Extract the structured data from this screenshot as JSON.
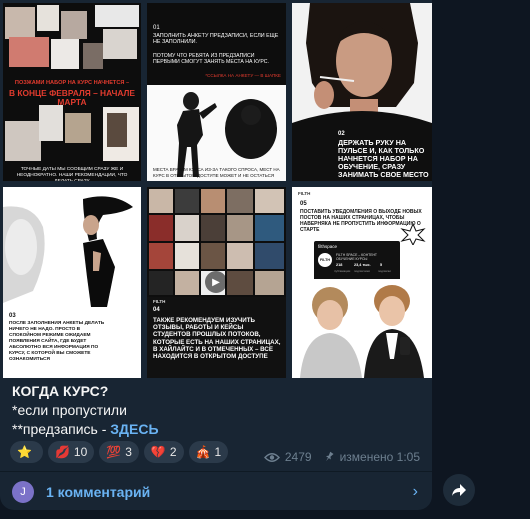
{
  "tiles": {
    "t1": {
      "headline_line1": "ПОЗЖАМИ НАБОР НА КУРС НАЧНЕТСЯ –",
      "headline_line2": "В КОНЦЕ ФЕВРАЛЯ – НАЧАЛЕ МАРТА",
      "footnote": "ТОЧНЫЕ ДАТЫ МЫ СООБЩИМ СРАЗУ ЖЕ И НЕОДНОКРАТНО. НАШИ РЕКОМЕНДАЦИИ, ЧТО ДЕЛАТЬ СРАЗУ"
    },
    "t2": {
      "number": "01",
      "text1": "ЗАПОЛНИТЬ АНКЕТУ ПРЕДЗАПИСИ, ЕСЛИ ЕЩЕ НЕ ЗАПОЛНИЛИ.",
      "text2": "ПОТОМУ ЧТО РЕБЯТА ИЗ ПРЕДЗАПИСИ ПЕРВЫМИ СМОГУТ ЗАНЯТЬ МЕСТА НА КУРС.",
      "text3": "*ССЫЛКА НА АНКЕТУ — В ШАПКЕ",
      "footnote": "МЕСТА ВРАЧАМ КУРСА ИЗ-ЗА ТАКОГО СПРОСА, МЕСТ НА КУРС В ОТКРЫТОМ ДОСТУПЕ МОЖЕТ И НЕ ОСТАТЬСЯ"
    },
    "t3": {
      "number": "02",
      "text": "ДЕРЖАТЬ РУКУ НА ПУЛЬСЕ И, КАК ТОЛЬКО НАЧНЕТСЯ НАБОР НА ОБУЧЕНИЕ, СРАЗУ ЗАНИМАТЬ СВОЕ МЕСТО"
    },
    "t4": {
      "brand": "FILTH",
      "number": "03",
      "text": "ПОСЛЕ ЗАПОЛНЕНИЯ АНКЕТЫ ДЕЛАТЬ НИЧЕГО НЕ НАДО. ПРОСТО В СПОКОЙНОМ РЕЖИМЕ ОЖИДАЕМ ПОЯВЛЕНИЯ САЙТА, ГДЕ БУДЕТ АБСОЛЮТНО ВСЯ ИНФОРМАЦИЯ ПО КУРСУ, С КОТОРОЙ ВЫ СМОЖЕТЕ ОЗНАКОМИТЬСЯ"
    },
    "t5": {
      "brand": "FILTH",
      "number": "04",
      "text": "ТАКЖЕ РЕКОМЕНДУЕМ ИЗУЧИТЬ ОТЗЫВЫ, РАБОТЫ И КЕЙСЫ СТУДЕНТОВ ПРОШЛЫХ ПОТОКОВ, КОТОРЫЕ ЕСТЬ НА НАШИХ СТРАНИЦАХ, В ХАЙЛАЙТС И В ОТМЕЧЕННЫХ – ВСЕ НАХОДИТСЯ В ОТКРЫТОМ ДОСТУПЕ"
    },
    "t6": {
      "brand": "FILTH",
      "number": "05",
      "text": "ПОСТАВИТЬ УВЕДОМЛЕНИЯ О ВЫХОДЕ НОВЫХ ПОСТОВ НА НАШИХ СТРАНИЦАХ, ЧТОБЫ НАВЕРНЯКА НЕ ПРОПУСТИТЬ ИНФОРМАЦИЮ О СТАРТЕ",
      "profile_handle": "filthspace",
      "profile_logo": "FILTH",
      "profile_bio": "FILTH SPACE – КОНТЕНТ ОБУЧЕНИЕ КУРСЫ",
      "stat1_value": "218",
      "stat1_label": "публикации",
      "stat2_value": "23,4 тыс.",
      "stat2_label": "подписчики",
      "stat3_value": "5",
      "stat3_label": "подписки"
    }
  },
  "caption": {
    "title": "КОГДА КУРС?",
    "line2": "*если пропустили",
    "line3_prefix": "**предзапись - ",
    "link": "ЗДЕСЬ"
  },
  "reactions": [
    {
      "emoji": "⭐",
      "count": ""
    },
    {
      "emoji": "💋",
      "count": "10"
    },
    {
      "emoji": "💯",
      "count": "3"
    },
    {
      "emoji": "💔",
      "count": "2"
    },
    {
      "emoji": "🎪",
      "count": "1"
    }
  ],
  "meta": {
    "views": "2479",
    "edited": "изменено 1:05"
  },
  "comments": {
    "avatar_letter": "J",
    "label": "1 комментарий"
  },
  "colors": {
    "background": "#0e1621",
    "bubble": "#182533",
    "link": "#6ab3f3",
    "accent_red": "#e23b2e"
  }
}
